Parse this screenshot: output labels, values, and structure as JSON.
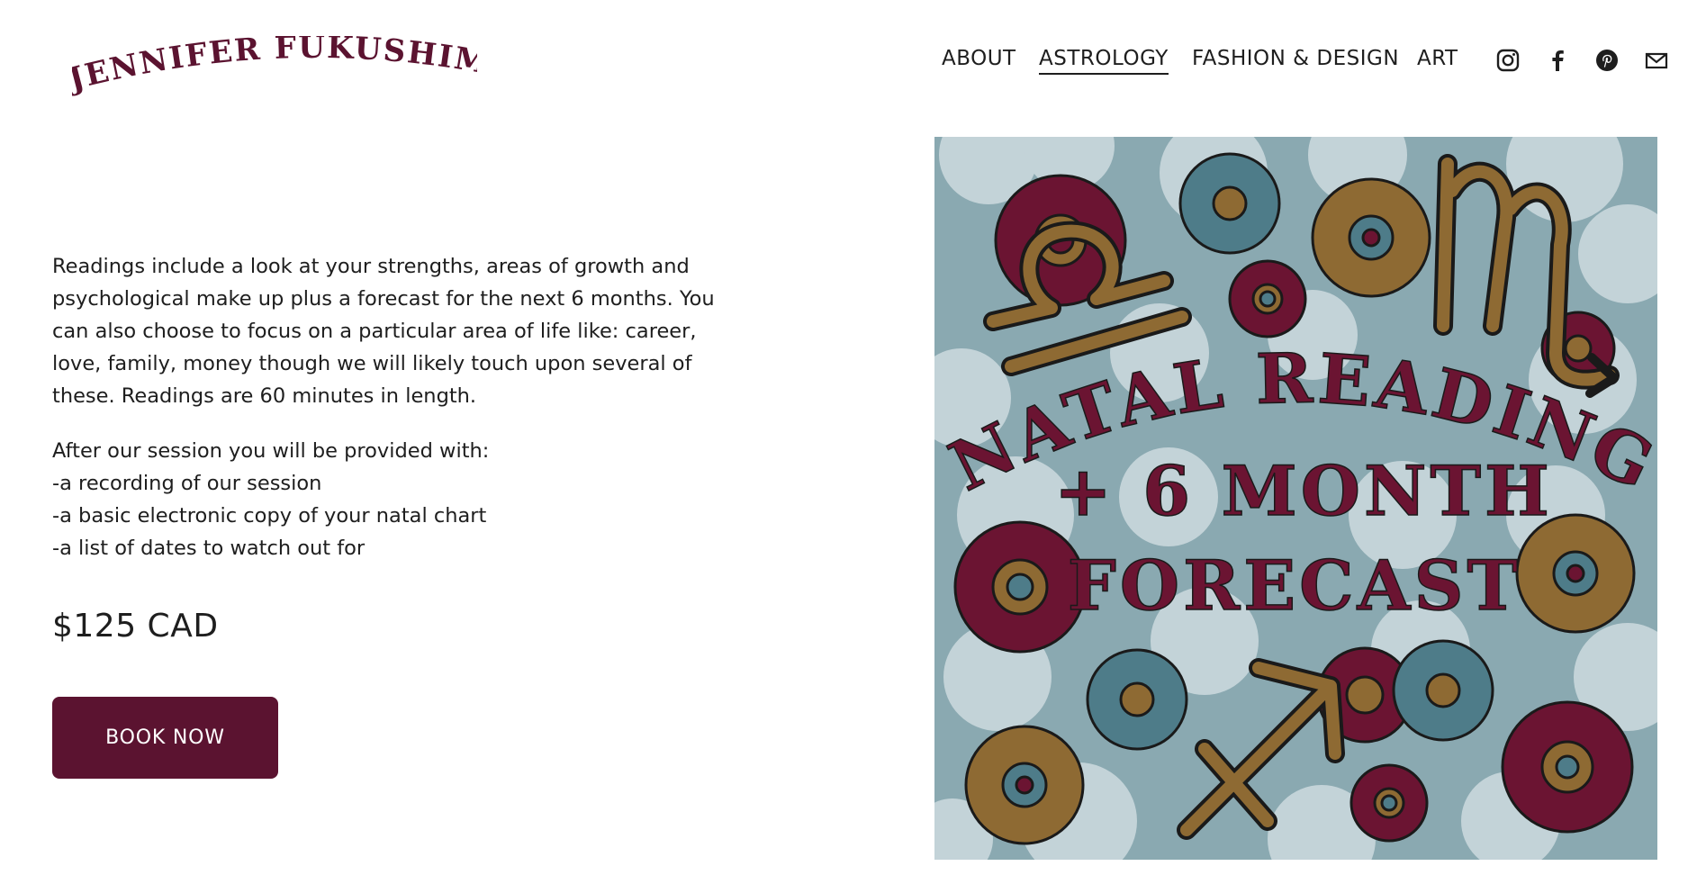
{
  "brand": {
    "name": "JENNIFER FUKUSHIMA",
    "color": "#5b1330"
  },
  "nav": {
    "items": [
      {
        "label": "ABOUT",
        "active": false
      },
      {
        "label": "ASTROLOGY",
        "active": true
      },
      {
        "label": "FASHION & DESIGN",
        "active": false
      },
      {
        "label": "ART",
        "active": false
      }
    ],
    "social": [
      "instagram-icon",
      "facebook-icon",
      "pinterest-icon",
      "email-icon"
    ]
  },
  "content": {
    "paragraph1": [
      "Readings include a look at your strengths, areas of growth and",
      "psychological make up plus a forecast for the next 6 months.  You",
      "can also choose to focus on a particular area of life like: career,",
      "love, family, money though we will likely touch upon several of",
      "these.  Readings are 60 minutes in length."
    ],
    "paragraph2": [
      "After our session you will be provided with:",
      "-a recording of our session",
      "-a basic electronic copy of your natal chart",
      "-a list of dates to watch out for"
    ],
    "price": "$125 CAD",
    "cta_label": "BOOK NOW"
  },
  "artwork": {
    "title_line1": "NATAL READING",
    "title_line2": "+ 6 MONTH",
    "title_line3": "FORECAST",
    "colors": {
      "background": "#8aa9b1",
      "cloud": "#c3d3d8",
      "maroon": "#6b1432",
      "gold": "#8e6a33",
      "teal": "#4e7c89"
    },
    "symbols": [
      "libra-glyph",
      "scorpio-glyph",
      "sagittarius-glyph"
    ]
  }
}
